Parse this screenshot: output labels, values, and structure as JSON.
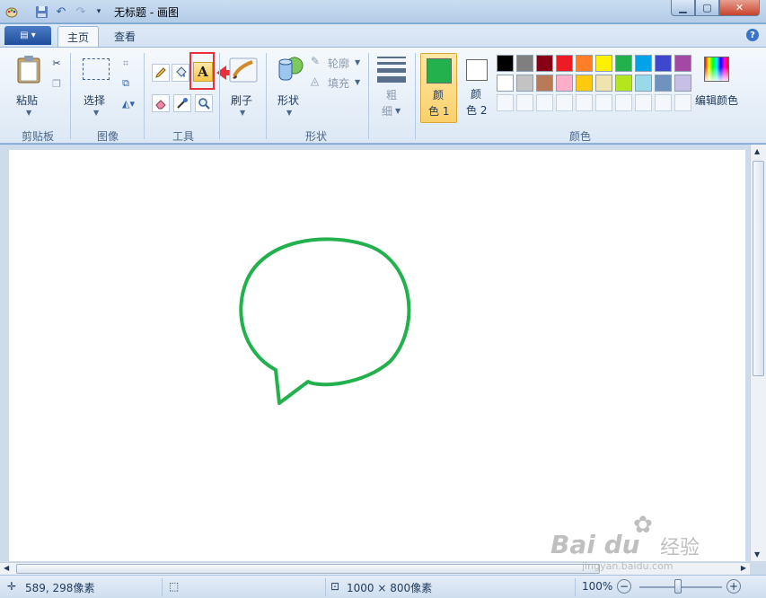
{
  "window": {
    "title": "无标题 - 画图",
    "min_glyph": "▁",
    "max_glyph": "▢",
    "close_glyph": "✕"
  },
  "tabs": [
    {
      "label": "主页",
      "active": true
    },
    {
      "label": "查看",
      "active": false
    }
  ],
  "help_glyph": "?",
  "ribbon": {
    "clipboard": {
      "paste_label": "粘贴",
      "group_label": "剪贴板"
    },
    "image": {
      "select_label": "选择",
      "group_label": "图像"
    },
    "tools": {
      "group_label": "工具",
      "text_tool_glyph": "A"
    },
    "brushes": {
      "label": "刷子"
    },
    "shapes": {
      "shapes_label": "形状",
      "outline_label": "轮廓",
      "fill_label": "填充",
      "group_label": "形状"
    },
    "size": {
      "label_line1": "粗",
      "label_line2": "细"
    },
    "colors": {
      "color1_line1": "颜",
      "color1_line2": "色 1",
      "color2_line1": "颜",
      "color2_line2": "色 2",
      "edit_label": "编辑颜色",
      "group_label": "颜色",
      "color1_value": "#22b14c",
      "color2_value": "#ffffff",
      "palette_row1": [
        "#000000",
        "#7f7f7f",
        "#880015",
        "#ed1c24",
        "#ff7f27",
        "#fff200",
        "#22b14c",
        "#00a2e8",
        "#3f48cc",
        "#a349a4"
      ],
      "palette_row2": [
        "#ffffff",
        "#c3c3c3",
        "#b97a57",
        "#ffaec9",
        "#ffc90e",
        "#efe4b0",
        "#b5e61d",
        "#99d9ea",
        "#7092be",
        "#c8bfe7"
      ]
    }
  },
  "canvas": {
    "shape": "speech-bubble",
    "stroke_color": "#22b14c"
  },
  "status": {
    "cursor_pos": "589, 298像素",
    "image_size": "1000 × 800像素",
    "zoom": "100%"
  },
  "watermark": {
    "brand": "Bai  du",
    "brand_cn": "经验",
    "url": "jingyan.baidu.com"
  }
}
